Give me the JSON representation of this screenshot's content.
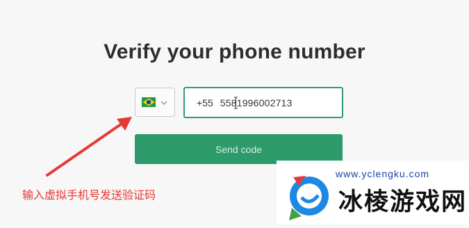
{
  "title": "Verify your phone number",
  "country_select": {
    "selected_country": "Brazil",
    "flag_icon": "flag-brazil-icon",
    "dropdown_icon": "chevron-down-icon"
  },
  "phone_input": {
    "country_code": "+55",
    "value": "5581996002713"
  },
  "send_button": {
    "label": "Send code"
  },
  "annotation": {
    "text": "输入虚拟手机号发送验证码",
    "color": "#e53935",
    "arrow_icon": "red-arrow-icon"
  },
  "watermark": {
    "url": "www.yclengku.com",
    "brand": "冰棱游戏网",
    "logo_icon": "watermark-logo-icon"
  },
  "colors": {
    "accent": "#2d9a6b",
    "input_border": "#2f9b6e",
    "background": "#f7f7f7"
  }
}
